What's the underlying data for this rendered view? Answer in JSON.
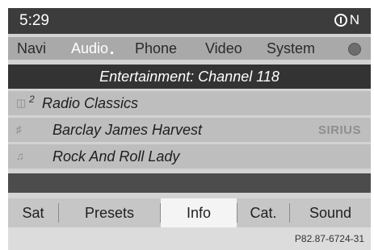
{
  "status": {
    "time": "5:29",
    "compass": "N"
  },
  "menu": {
    "items": [
      "Navi",
      "Audio",
      "Phone",
      "Video",
      "System"
    ],
    "active": "Audio"
  },
  "header": {
    "title": "Entertainment: Channel 118"
  },
  "rows": [
    {
      "num": "2",
      "text": "Radio Classics",
      "icon": "signal-icon"
    },
    {
      "text": "Barclay James Harvest",
      "icon": "artist-icon",
      "logo": "SIRIUS"
    },
    {
      "text": "Rock And Roll Lady",
      "icon": "music-note-icon"
    }
  ],
  "softkeys": [
    "Sat",
    "Presets",
    "Info",
    "Cat.",
    "Sound"
  ],
  "softkeys_selected": "Info",
  "figure_code": "P82.87-6724-31"
}
